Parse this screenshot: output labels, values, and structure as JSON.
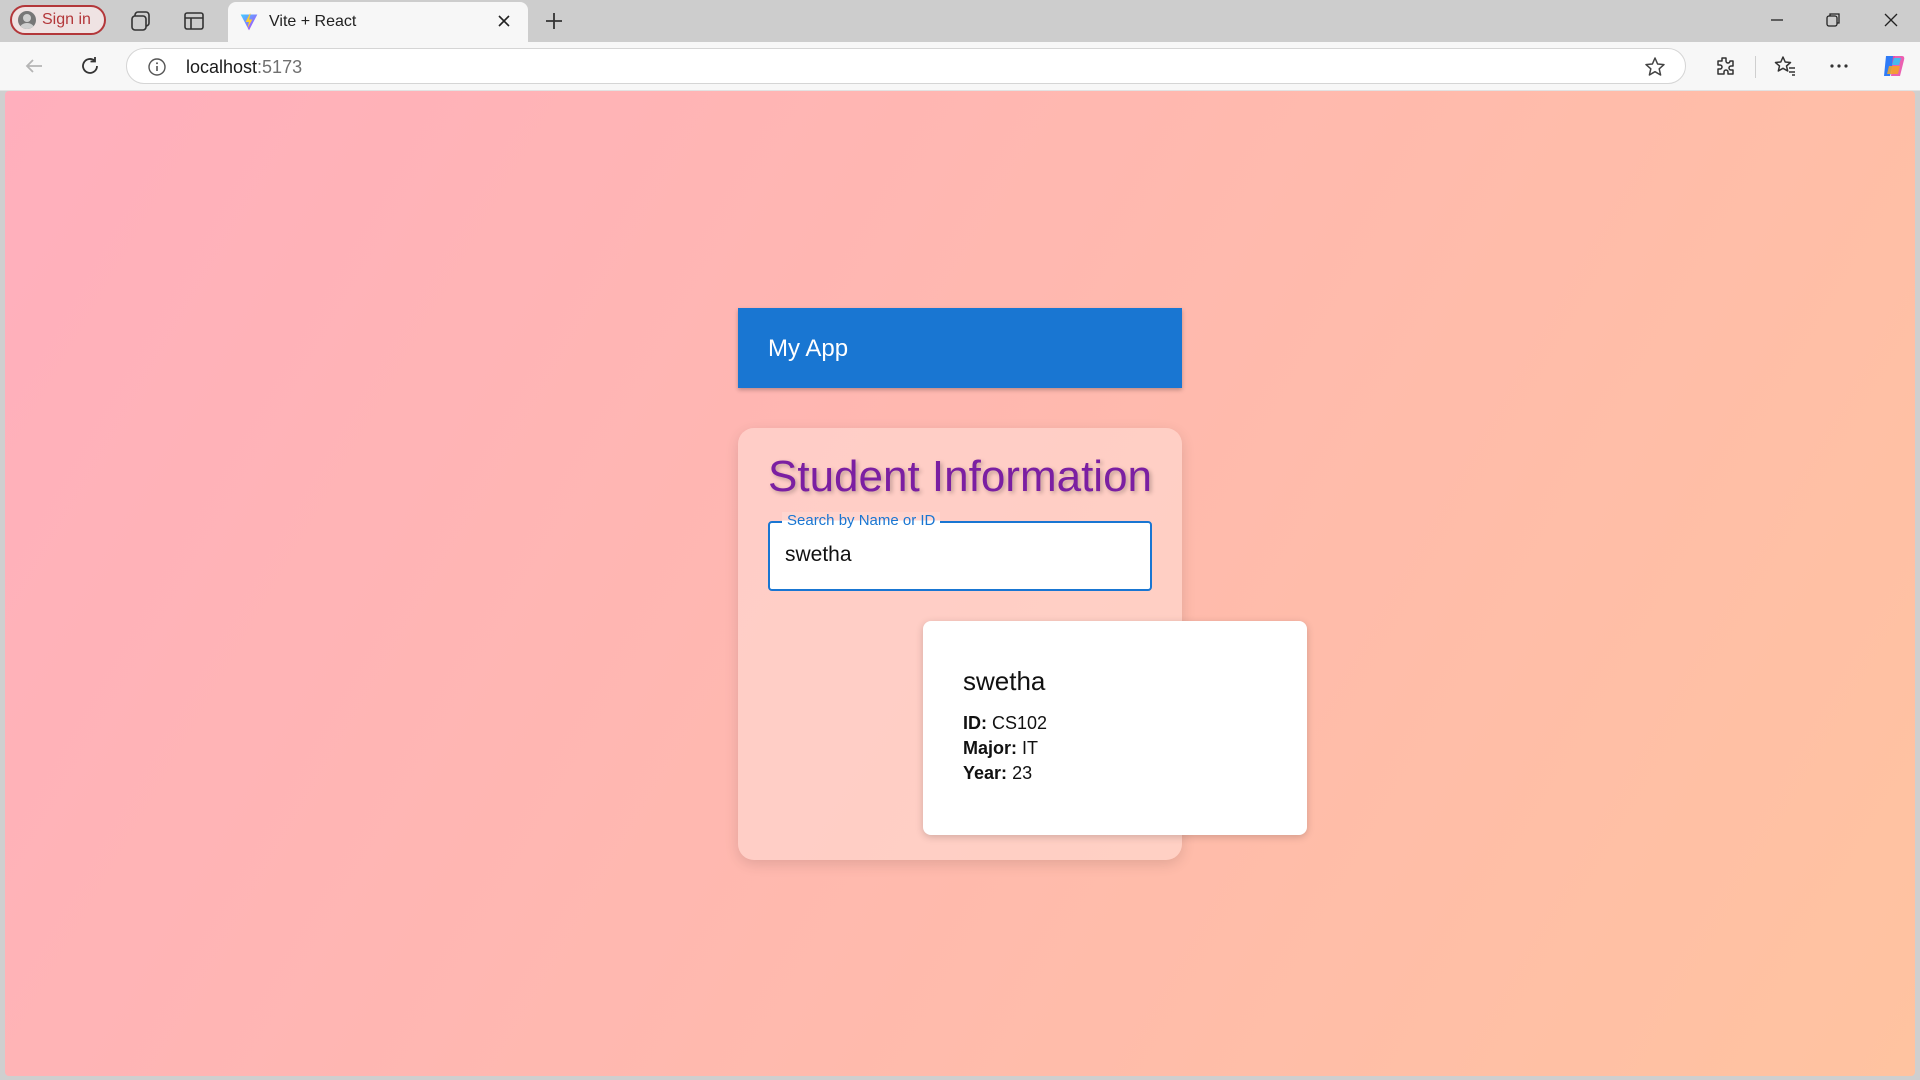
{
  "browser": {
    "signin_label": "Sign in",
    "tab_title": "Vite + React",
    "url_host": "localhost",
    "url_port": ":5173",
    "accent": "#b3373a"
  },
  "app": {
    "appbar_title": "My App",
    "appbar_color": "#1976d2",
    "card_title": "Student Information",
    "title_color": "#7b1fa2",
    "search": {
      "label": "Search by Name or ID",
      "value": "swetha"
    },
    "result": {
      "name": "swetha",
      "id_label": "ID:",
      "id_value": "CS102",
      "major_label": "Major:",
      "major_value": "IT",
      "year_label": "Year:",
      "year_value": "23"
    }
  },
  "icons": [
    "profile-icon",
    "workspaces-icon",
    "tab-actions-icon",
    "vite-logo-icon",
    "close-icon",
    "plus-icon",
    "minimize-icon",
    "restore-icon",
    "window-close-icon",
    "back-icon",
    "refresh-icon",
    "info-icon",
    "star-icon",
    "extensions-icon",
    "favorites-icon",
    "more-icon",
    "copilot-icon"
  ]
}
